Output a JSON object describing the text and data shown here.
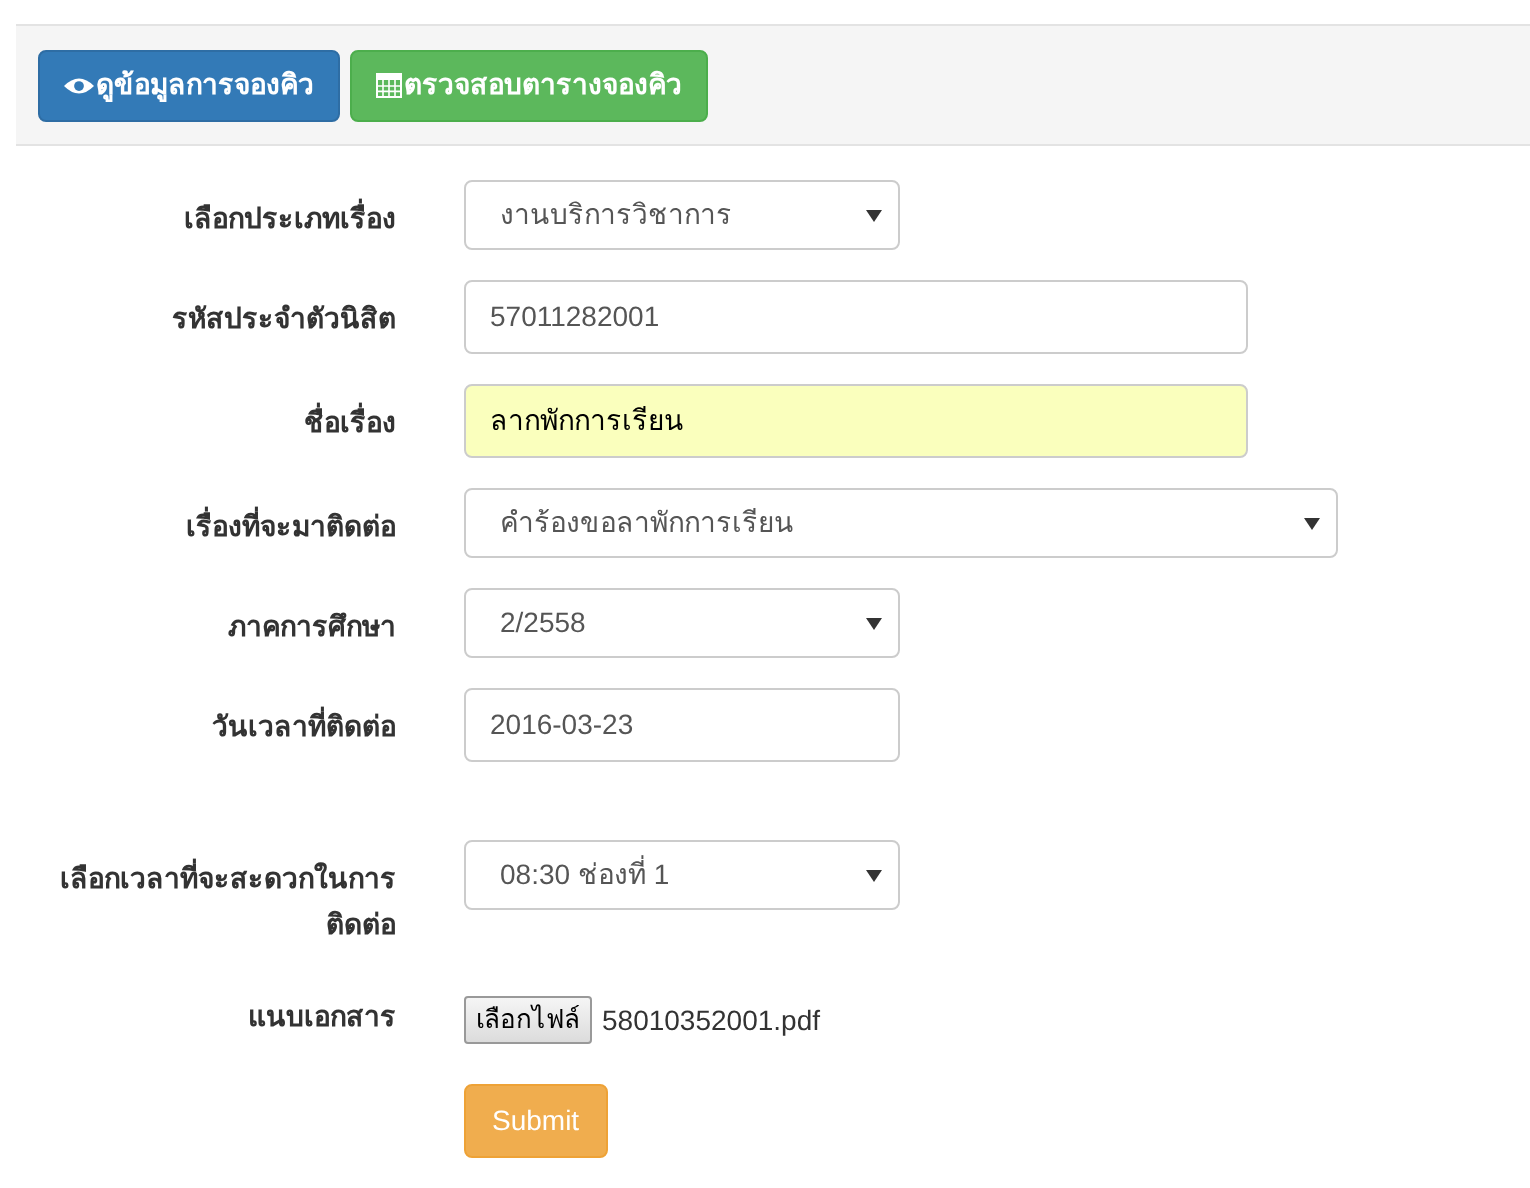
{
  "toolbar": {
    "buttons": [
      {
        "label": "ดูข้อมูลการจองคิว",
        "kind": "view"
      },
      {
        "label": "ตรวจสอบตารางจองคิว",
        "kind": "calendar"
      }
    ]
  },
  "form": {
    "fields": [
      {
        "label": "เลือกประเภทเรื่อง",
        "kind": "select",
        "value": "งานบริการวิชาการ"
      },
      {
        "label": "รหัสประจำตัวนิสิต",
        "kind": "text",
        "value": "57011282001",
        "highlighted": false
      },
      {
        "label": "ชื่อเรื่อง",
        "kind": "text",
        "value": "ลากพักการเรียน",
        "highlighted": true
      },
      {
        "label": "เรื่องที่จะมาติดต่อ",
        "kind": "select",
        "value": "คำร้องขอลาพักการเรียน"
      },
      {
        "label": "ภาคการศึกษา",
        "kind": "select",
        "value": "2/2558"
      },
      {
        "label": "วันเวลาที่ติดต่อ",
        "kind": "text",
        "value": "2016-03-23",
        "highlighted": false
      },
      {
        "label": "เลือกเวลาที่จะสะดวกในการติดต่อ",
        "kind": "select",
        "value": "08:30 ช่องที่ 1"
      },
      {
        "label": "แนบเอกสาร",
        "kind": "file",
        "button": "เลือกไฟล์",
        "value": "58010352001.pdf"
      }
    ],
    "submit": "Submit"
  }
}
